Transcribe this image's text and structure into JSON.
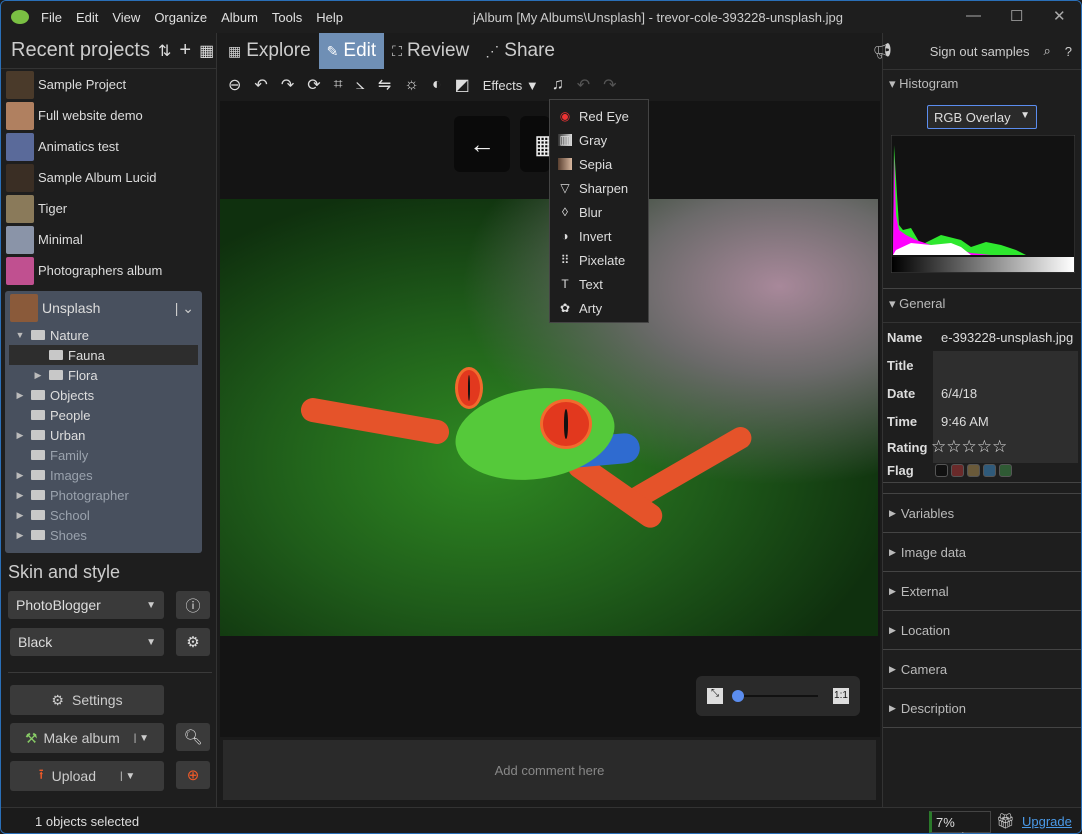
{
  "window": {
    "title": "jAlbum [My Albums\\Unsplash] - trevor-cole-393228-unsplash.jpg",
    "menu": [
      "File",
      "Edit",
      "View",
      "Organize",
      "Album",
      "Tools",
      "Help"
    ]
  },
  "left": {
    "recent_title": "Recent projects",
    "projects": [
      {
        "name": "Sample Project",
        "color": "#4a3a2a"
      },
      {
        "name": "Full website demo",
        "color": "#b08060"
      },
      {
        "name": "Animatics test",
        "color": "#5a6a9a"
      },
      {
        "name": "Sample Album Lucid",
        "color": "#3a2e24"
      },
      {
        "name": "Tiger",
        "color": "#8a7a5a"
      },
      {
        "name": "Minimal",
        "color": "#8a94a8"
      },
      {
        "name": "Photographers album",
        "color": "#c05090"
      }
    ],
    "album": {
      "name": "Unsplash",
      "tree": [
        {
          "label": "Nature",
          "level": 0,
          "arrow": "▼",
          "open": true
        },
        {
          "label": "Fauna",
          "level": 1,
          "arrow": "",
          "open": true,
          "selected": true
        },
        {
          "label": "Flora",
          "level": 1,
          "arrow": "▶"
        },
        {
          "label": "Objects",
          "level": 0,
          "arrow": "▶"
        },
        {
          "label": "People",
          "level": 0,
          "arrow": "",
          "open": true
        },
        {
          "label": "Urban",
          "level": 0,
          "arrow": "▶"
        },
        {
          "label": "Family",
          "level": 0,
          "arrow": "",
          "open": true,
          "dim": true
        },
        {
          "label": "Images",
          "level": 0,
          "arrow": "▶",
          "dim": true
        },
        {
          "label": "Photographer",
          "level": 0,
          "arrow": "▶",
          "dim": true
        },
        {
          "label": "School",
          "level": 0,
          "arrow": "▶",
          "dim": true
        },
        {
          "label": "Shoes",
          "level": 0,
          "arrow": "▶",
          "dim": true
        }
      ]
    },
    "skin_title": "Skin and style",
    "skin": "PhotoBlogger",
    "style": "Black",
    "settings": "Settings",
    "make_album": "Make album",
    "upload": "Upload"
  },
  "center": {
    "tabs": [
      "Explore",
      "Edit",
      "Review",
      "Share"
    ],
    "active_tab": "Edit",
    "effects_label": "Effects ▼",
    "effects": [
      {
        "label": "Red Eye",
        "icon": "red-eye"
      },
      {
        "label": "Gray",
        "icon": "gray"
      },
      {
        "label": "Sepia",
        "icon": "sepia"
      },
      {
        "label": "Sharpen",
        "icon": "sharpen"
      },
      {
        "label": "Blur",
        "icon": "blur"
      },
      {
        "label": "Invert",
        "icon": "invert"
      },
      {
        "label": "Pixelate",
        "icon": "pixelate"
      },
      {
        "label": "Text",
        "icon": "text"
      },
      {
        "label": "Arty",
        "icon": "arty"
      }
    ],
    "comment_placeholder": "Add comment here",
    "zoom_level": 0,
    "one_to_one": "1:1"
  },
  "right": {
    "sign_out": "Sign out samples",
    "histogram_title": "Histogram",
    "histogram_mode": "RGB Overlay",
    "general_title": "General",
    "general": {
      "name_label": "Name",
      "name": "e-393228-unsplash.jpg",
      "title_label": "Title",
      "title": "",
      "date_label": "Date",
      "date": "6/4/18",
      "time_label": "Time",
      "time": "9:46 AM",
      "rating_label": "Rating",
      "rating": 0,
      "flag_label": "Flag",
      "flags": [
        "#111111",
        "#6a2a2a",
        "#6a5a3a",
        "#2f5a7a",
        "#2f5a34"
      ]
    },
    "sections": [
      "Variables",
      "Image data",
      "External",
      "Location",
      "Camera",
      "Description"
    ]
  },
  "status": {
    "selected": "1 objects selected",
    "usage": "7% used",
    "usage_percent": 7,
    "upgrade": "Upgrade"
  }
}
